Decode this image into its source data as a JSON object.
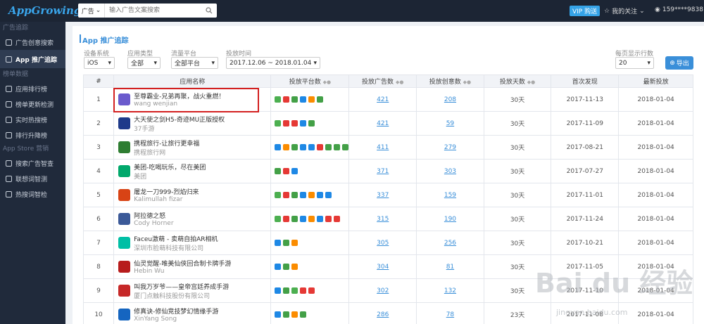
{
  "logo": "AppGrowing",
  "topbar": {
    "search_type": "广告",
    "search_placeholder": "输入广告文案搜索",
    "vip_label": "VIP 购送",
    "follow_label": "我的关注",
    "user_phone": "159****9838"
  },
  "sidebar": {
    "sections": [
      {
        "title": "广告追踪",
        "items": [
          {
            "label": "广告创意搜索"
          },
          {
            "label": "App 推广追踪",
            "active": true
          }
        ]
      },
      {
        "title": "榜单数据",
        "items": [
          {
            "label": "应用排行榜"
          },
          {
            "label": "榜单更新检测"
          },
          {
            "label": "实时热搜榜"
          },
          {
            "label": "排行升降榜"
          }
        ]
      },
      {
        "title": "App Store 营销",
        "items": [
          {
            "label": "搜索广告智查"
          },
          {
            "label": "联想词智测"
          },
          {
            "label": "热搜词智检"
          }
        ]
      }
    ]
  },
  "page": {
    "title": "App 推广追踪",
    "filters": {
      "os": {
        "label": "设备系统",
        "value": "iOS"
      },
      "app_type": {
        "label": "应用类型",
        "value": "全部"
      },
      "traffic": {
        "label": "流量平台",
        "value": "全部平台"
      },
      "date": {
        "label": "投放时间",
        "value": "2017.12.06 ~ 2018.01.04"
      },
      "per_page": {
        "label": "每页显示行数",
        "value": "20"
      }
    },
    "export_label": "导出"
  },
  "table": {
    "headers": [
      "#",
      "应用名称",
      "投放平台数",
      "投放广告数",
      "投放创意数",
      "投放天数",
      "首次发现",
      "最新投放"
    ],
    "rows": [
      {
        "num": "1",
        "name": "至尊霸业-兄弟再聚，战火重燃！",
        "dev": "wang wenjian",
        "platforms": [
          "#4caf50",
          "#e53935",
          "#43a047",
          "#1e88e5",
          "#fb8c00",
          "#43a047"
        ],
        "ads": "421",
        "creatives": "208",
        "days": "30天",
        "first": "2017-11-13",
        "last": "2018-01-04"
      },
      {
        "num": "2",
        "name": "大天使之剑H5-奇迹MU正版授权",
        "dev": "37手游",
        "platforms": [
          "#4caf50",
          "#e53935",
          "#e53935",
          "#1e88e5",
          "#43a047"
        ],
        "ads": "421",
        "creatives": "59",
        "days": "30天",
        "first": "2017-11-09",
        "last": "2018-01-04"
      },
      {
        "num": "3",
        "name": "携程旅行-让旅行更幸福",
        "dev": "携程旅行网",
        "platforms": [
          "#1e88e5",
          "#fb8c00",
          "#43a047",
          "#1e88e5",
          "#1e88e5",
          "#e53935",
          "#43a047",
          "#43a047",
          "#43a047"
        ],
        "ads": "411",
        "creatives": "279",
        "days": "30天",
        "first": "2017-08-21",
        "last": "2018-01-04"
      },
      {
        "num": "4",
        "name": "美团-吃喝玩乐，尽在美团",
        "dev": "美团",
        "platforms": [
          "#43a047",
          "#e53935",
          "#1e88e5"
        ],
        "ads": "371",
        "creatives": "303",
        "days": "30天",
        "first": "2017-07-27",
        "last": "2018-01-04"
      },
      {
        "num": "5",
        "name": "屠龙一刀999-烈焰归来",
        "dev": "Kalimullah fizar",
        "platforms": [
          "#4caf50",
          "#e53935",
          "#43a047",
          "#1e88e5",
          "#fb8c00",
          "#1e88e5",
          "#1e88e5"
        ],
        "ads": "337",
        "creatives": "159",
        "days": "30天",
        "first": "2017-11-01",
        "last": "2018-01-04"
      },
      {
        "num": "6",
        "name": "阿拉德之怒",
        "dev": "Cody Horner",
        "platforms": [
          "#4caf50",
          "#e53935",
          "#43a047",
          "#1e88e5",
          "#fb8c00",
          "#1e88e5",
          "#e53935",
          "#e53935"
        ],
        "ads": "315",
        "creatives": "190",
        "days": "30天",
        "first": "2017-11-24",
        "last": "2018-01-04"
      },
      {
        "num": "7",
        "name": "Faceu激萌 - 卖萌自拍AR相机",
        "dev": "深圳市脸萌科技有限公司",
        "platforms": [
          "#1e88e5",
          "#43a047",
          "#fb8c00"
        ],
        "ads": "305",
        "creatives": "256",
        "days": "30天",
        "first": "2017-10-21",
        "last": "2018-01-04"
      },
      {
        "num": "8",
        "name": "仙灵觉醒-唯美仙侠回合制卡牌手游",
        "dev": "Hebin Wu",
        "platforms": [
          "#1e88e5",
          "#43a047",
          "#fb8c00"
        ],
        "ads": "304",
        "creatives": "81",
        "days": "30天",
        "first": "2017-11-05",
        "last": "2018-01-04"
      },
      {
        "num": "9",
        "name": "叫我万岁爷——皇帝宫廷养成手游",
        "dev": "厦门点触科技股份有限公司",
        "platforms": [
          "#1e88e5",
          "#43a047",
          "#4caf50",
          "#e53935",
          "#e53935"
        ],
        "ads": "302",
        "creatives": "132",
        "days": "30天",
        "first": "2017-11-10",
        "last": "2018-01-04"
      },
      {
        "num": "10",
        "name": "修真诀-修仙竞技梦幻情缘手游",
        "dev": "XinYang Song",
        "platforms": [
          "#1e88e5",
          "#43a047",
          "#fb8c00",
          "#43a047"
        ],
        "ads": "286",
        "creatives": "78",
        "days": "23天",
        "first": "2017-11-08",
        "last": "2018-01-04"
      }
    ]
  },
  "watermark": {
    "main": "Bai du 经验",
    "sub": "jingyan.baidu.com"
  },
  "colors": {
    "accent": "#3a8fd9",
    "sidebar": "#202a3b",
    "topbar": "#1c2534",
    "highlight": "#d32020"
  }
}
